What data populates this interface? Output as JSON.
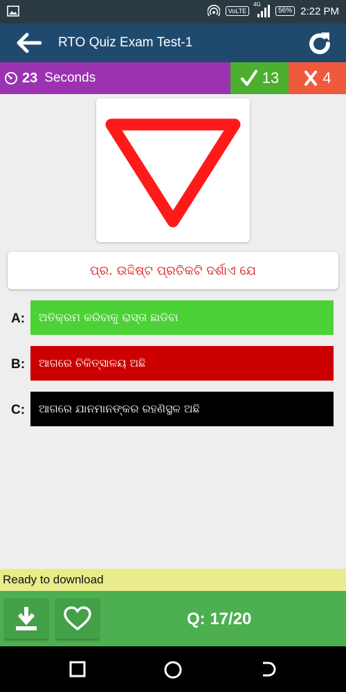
{
  "status_bar": {
    "volte": "VoLTE",
    "network": "4G",
    "battery": "56%",
    "time": "2:22 PM"
  },
  "app_bar": {
    "title": "RTO Quiz Exam Test-1"
  },
  "score_bar": {
    "timer_value": "23",
    "timer_label": "Seconds",
    "correct_count": "13",
    "wrong_count": "4",
    "colors": {
      "timer": "#9b33b0",
      "correct": "#4caf2f",
      "wrong": "#f05a3c"
    }
  },
  "sign": {
    "icon": "give-way-triangle",
    "color": "#ff1a1a"
  },
  "question": {
    "text": "ପ୍ର. ଉଦ୍ଦିଷ୍ଟ ପ୍ରତିକଟି ଦର୍ଶାଏ ଯେ"
  },
  "options": [
    {
      "label": "A:",
      "text": "ଅତିକ୍ରମ କରିବାକୁ ରାସ୍ତା ଛାଡିବା",
      "color": "#4cd137"
    },
    {
      "label": "B:",
      "text": "ଆଗରେ ଚିକିତ୍ସାଳୟ ଅଛି",
      "color": "#cc0000"
    },
    {
      "label": "C:",
      "text": "ଆଗରେ ଯାନମାନଙ୍କର ରହଣିସ୍ଥଳ ଅଛି",
      "color": "#000000"
    }
  ],
  "ad": {
    "text": "Ready to download"
  },
  "bottom_bar": {
    "question_counter": "Q: 17/20"
  }
}
